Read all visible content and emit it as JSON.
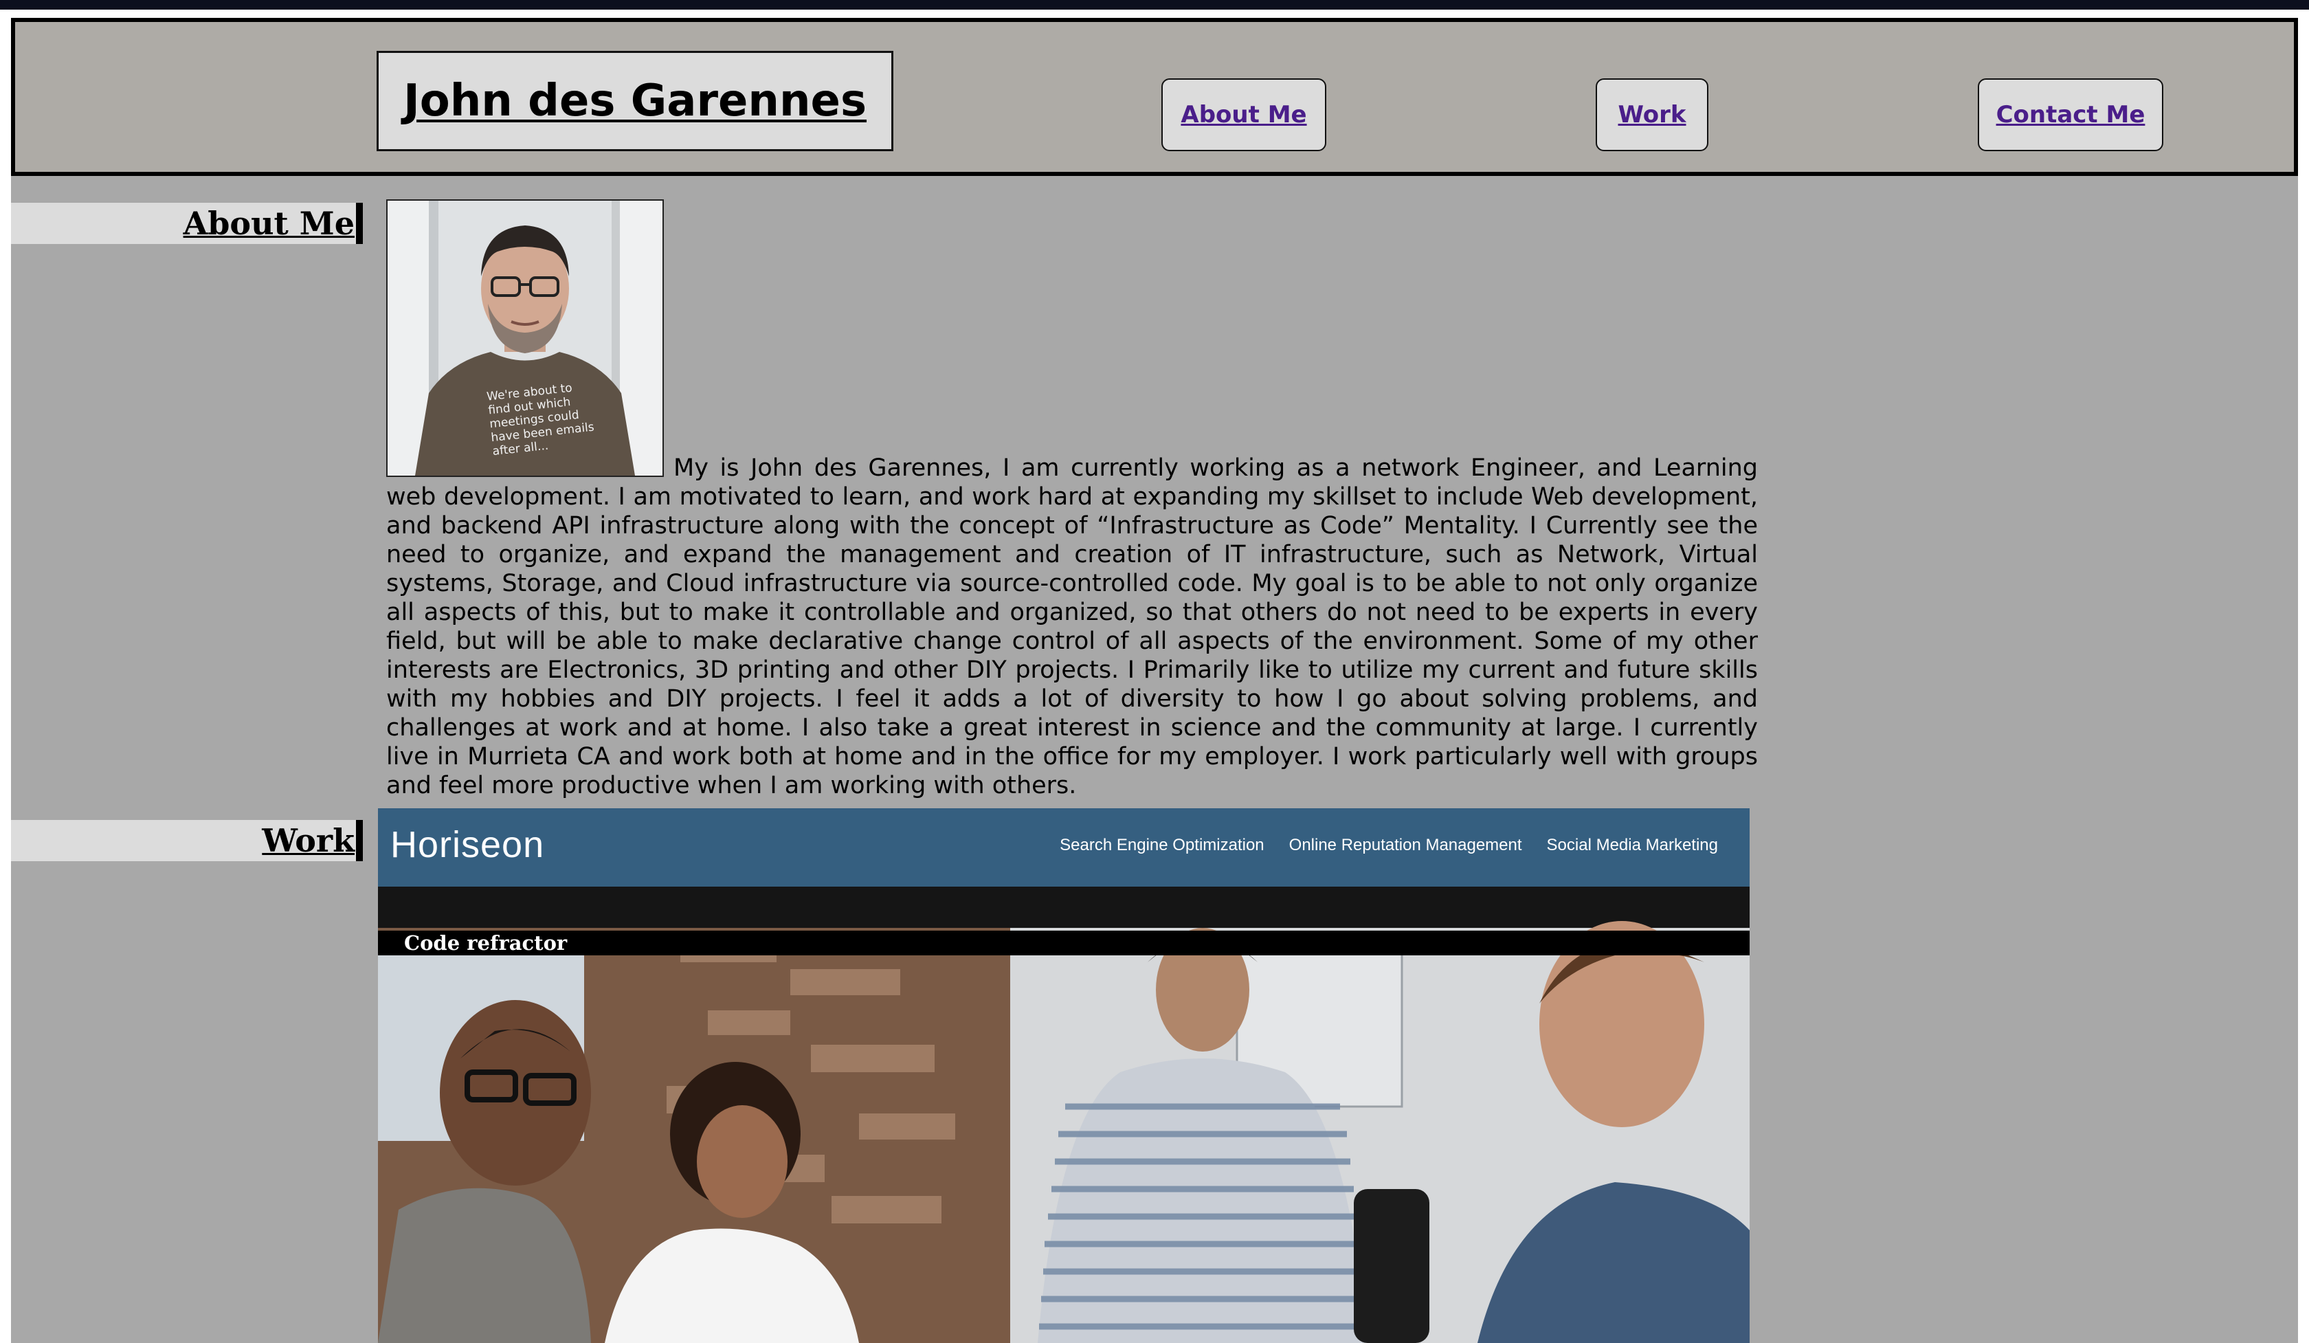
{
  "header": {
    "site_title": "John des Garennes",
    "nav": [
      {
        "label": "About Me"
      },
      {
        "label": "Work"
      },
      {
        "label": "Contact Me"
      }
    ]
  },
  "about": {
    "heading": "About Me",
    "portrait_shirt_text": [
      "We're about to",
      "find out which",
      "meetings could",
      "have been emails",
      "after all..."
    ],
    "bio": "My is John des Garennes, I am currently working as a network Engineer, and Learning web development. I am motivated to learn, and work hard at expanding my skillset to include Web development, and backend API infrastructure along with the concept of “Infrastructure as Code” Mentality. I Currently see the need to organize, and expand the management and creation of IT infrastructure, such as Network, Virtual systems, Storage, and Cloud infrastructure via source-controlled code. My goal is to be able to not only organize all aspects of this, but to make it controllable and organized, so that others do not need to be experts in every field, but will be able to make declarative change control of all aspects of the environment. Some of my other interests are Electronics, 3D printing and other DIY projects. I Primarily like to utilize my current and future skills with my hobbies and DIY projects. I feel it adds a lot of diversity to how I go about solving problems, and challenges at work and at home. I also take a great interest in science and the community at large. I currently live in Murrieta CA and work both at home and in the office for my employer. I work particularly well with groups and feel more productive when I am working with others."
  },
  "work": {
    "heading": "Work",
    "project": {
      "brand": "Horiseon",
      "links": [
        "Search Engine Optimization",
        "Online Reputation Management",
        "Social Media Marketing"
      ],
      "caption": "Code refractor"
    }
  },
  "colors": {
    "page_bg": "#a8a8a8",
    "header_bg": "#aeaba6",
    "button_bg": "#dcdcdc",
    "link": "#4a1e8a",
    "project_nav": "#355f80"
  }
}
